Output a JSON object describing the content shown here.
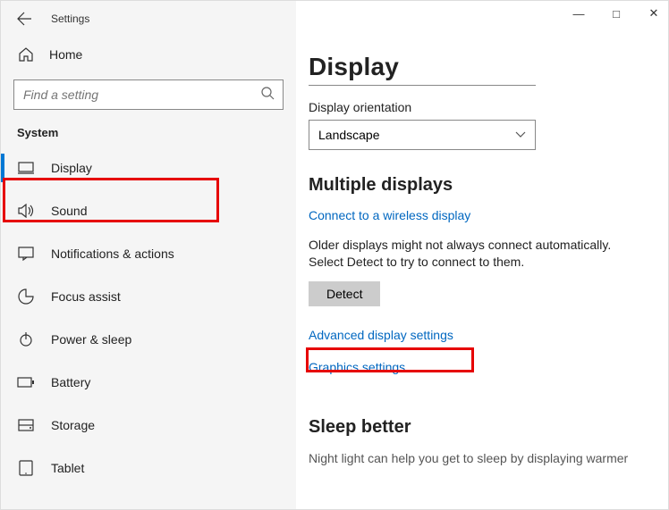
{
  "window": {
    "title": "Settings",
    "minimize": "—",
    "maximize": "□",
    "close": "✕"
  },
  "home": {
    "label": "Home"
  },
  "search": {
    "placeholder": "Find a setting"
  },
  "category": "System",
  "nav": {
    "items": [
      {
        "label": "Display"
      },
      {
        "label": "Sound"
      },
      {
        "label": "Notifications & actions"
      },
      {
        "label": "Focus assist"
      },
      {
        "label": "Power & sleep"
      },
      {
        "label": "Battery"
      },
      {
        "label": "Storage"
      },
      {
        "label": "Tablet"
      }
    ]
  },
  "main": {
    "heading": "Display",
    "orientation": {
      "label": "Display orientation",
      "value": "Landscape"
    },
    "multiple": {
      "heading": "Multiple displays",
      "wireless_link": "Connect to a wireless display",
      "desc": "Older displays might not always connect automatically. Select Detect to try to connect to them.",
      "detect_btn": "Detect",
      "advanced_link": "Advanced display settings",
      "graphics_link": "Graphics settings"
    },
    "sleep": {
      "heading": "Sleep better",
      "desc": "Night light can help you get to sleep by displaying warmer"
    }
  }
}
